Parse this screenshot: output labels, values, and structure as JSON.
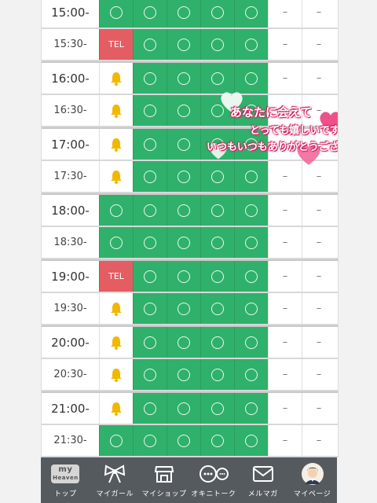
{
  "schedule": {
    "rows": [
      {
        "time": "15:00-",
        "cells": [
          "circle",
          "circle",
          "circle",
          "circle",
          "circle",
          "dash",
          "dash"
        ]
      },
      {
        "time": "15:30-",
        "cells": [
          "tel",
          "circle",
          "circle",
          "circle",
          "circle",
          "dash",
          "dash"
        ]
      },
      {
        "time": "16:00-",
        "cells": [
          "bell",
          "circle",
          "circle",
          "circle",
          "circle",
          "dash",
          "dash"
        ]
      },
      {
        "time": "16:30-",
        "cells": [
          "bell",
          "circle",
          "circle",
          "circle",
          "circle",
          "dash",
          "dash"
        ]
      },
      {
        "time": "17:00-",
        "cells": [
          "bell",
          "circle",
          "circle",
          "circle",
          "circle",
          "dash",
          "dash"
        ]
      },
      {
        "time": "17:30-",
        "cells": [
          "bell",
          "circle",
          "circle",
          "circle",
          "circle",
          "dash",
          "dash"
        ]
      },
      {
        "time": "18:00-",
        "cells": [
          "circle",
          "circle",
          "circle",
          "circle",
          "circle",
          "dash",
          "dash"
        ]
      },
      {
        "time": "18:30-",
        "cells": [
          "circle",
          "circle",
          "circle",
          "circle",
          "circle",
          "dash",
          "dash"
        ]
      },
      {
        "time": "19:00-",
        "cells": [
          "tel",
          "circle",
          "circle",
          "circle",
          "circle",
          "dash",
          "dash"
        ]
      },
      {
        "time": "19:30-",
        "cells": [
          "bell",
          "circle",
          "circle",
          "circle",
          "circle",
          "dash",
          "dash"
        ]
      },
      {
        "time": "20:00-",
        "cells": [
          "bell",
          "circle",
          "circle",
          "circle",
          "circle",
          "dash",
          "dash"
        ]
      },
      {
        "time": "20:30-",
        "cells": [
          "bell",
          "circle",
          "circle",
          "circle",
          "circle",
          "dash",
          "dash"
        ]
      },
      {
        "time": "21:00-",
        "cells": [
          "bell",
          "circle",
          "circle",
          "circle",
          "circle",
          "dash",
          "dash"
        ]
      },
      {
        "time": "21:30-",
        "cells": [
          "circle",
          "circle",
          "circle",
          "circle",
          "circle",
          "dash",
          "dash"
        ]
      }
    ],
    "tel_label": "TEL",
    "dash_label": "–",
    "colors": {
      "available": "#2fb16b",
      "tel": "#e35d63",
      "bell": "#f3b700"
    }
  },
  "stamp": {
    "line1": "あなたに会えて",
    "line2": "とっても嬉しいです",
    "line3": "いつもいつもありがとうございます"
  },
  "tabbar": {
    "items": [
      {
        "icon": "my-heaven-logo-icon",
        "logo_top": "my",
        "logo_bottom": "Heaven",
        "label": "トップ"
      },
      {
        "icon": "ribbon-icon",
        "label": "マイガール"
      },
      {
        "icon": "shop-icon",
        "label": "マイショップ"
      },
      {
        "icon": "chat-bubbles-icon",
        "label": "オキニトーク"
      },
      {
        "icon": "mail-icon",
        "label": "メルマガ"
      },
      {
        "icon": "avatar-icon",
        "label": "マイページ"
      }
    ]
  }
}
